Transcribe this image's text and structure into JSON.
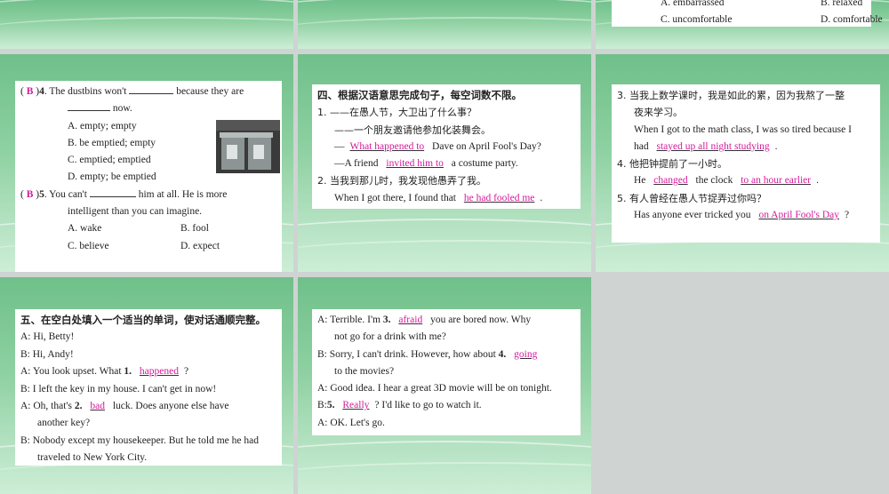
{
  "top_right": {
    "opt_a": "A. embarrassed",
    "opt_b": "B. relaxed",
    "opt_c": "C. uncomfortable",
    "opt_d": "D. comfortable"
  },
  "q4": {
    "answer": "B",
    "num": "4",
    "stem_start": ". The dustbins won't",
    "stem_end": "because they are",
    "stem_line2": "now.",
    "opt_a": "A. empty; empty",
    "opt_b": "B. be emptied; empty",
    "opt_c": "C. emptied; emptied",
    "opt_d": "D. empty; be emptied"
  },
  "q5": {
    "answer": "B",
    "num": "5",
    "stem_start": ". You can't",
    "stem_end": "him at all. He is more",
    "stem_line2": "intelligent than you can imagine.",
    "opt_a": "A. wake",
    "opt_b": "B. fool",
    "opt_c": "C. believe",
    "opt_d": "D. expect"
  },
  "section4": {
    "heading": "四、根据汉语意思完成句子，每空词数不限。",
    "s1_cn": "1. ——在愚人节，大卫出了什么事？",
    "s1_cn2": "——一个朋友邀请他参加化装舞会。",
    "s1_en1_pre": "—",
    "s1_en1_ans": "What happened to",
    "s1_en1_post": "Dave on April Fool's Day?",
    "s1_en2_pre": "—A friend",
    "s1_en2_ans": "invited him to",
    "s1_en2_post": "a costume party.",
    "s2_cn": "2. 当我到那儿时，我发现他愚弄了我。",
    "s2_en_pre": "When I got there, I found that",
    "s2_en_ans": "he had fooled me",
    "s2_en_post": "."
  },
  "section4b": {
    "s3_cn": "3. 当我上数学课时，我是如此的累，因为我熬了一整",
    "s3_cn2": "夜来学习。",
    "s3_en1": "When I got to the math class, I was so tired because I",
    "s3_en2_pre": "had",
    "s3_en2_ans": "stayed up all night studying",
    "s3_en2_post": ".",
    "s4_cn": "4. 他把钟提前了一小时。",
    "s4_en_pre": "He",
    "s4_en_ans1": "changed",
    "s4_en_mid": "the clock",
    "s4_en_ans2": "to an hour earlier",
    "s4_en_post": ".",
    "s5_cn": "5. 有人曾经在愚人节捉弄过你吗？",
    "s5_en_pre": "Has anyone ever tricked you",
    "s5_en_ans": "on April Fool's Day",
    "s5_en_post": "?"
  },
  "section5": {
    "heading": "五、在空白处填入一个适当的单词，使对话通顺完整。",
    "l1": "A: Hi, Betty!",
    "l2": "B: Hi, Andy!",
    "l3_pre": "A: You look upset. What",
    "l3_num": "1.",
    "l3_ans": "happened",
    "l3_post": "?",
    "l4": "B: I left the key in my house. I can't get in now!",
    "l5_pre": "A: Oh, that's",
    "l5_num": "2.",
    "l5_ans": "bad",
    "l5_post": "luck. Does anyone else have",
    "l6": "another key?",
    "l7": "B: Nobody except my housekeeper. But he told me he had",
    "l8": "traveled to New York City."
  },
  "section5b": {
    "l1_pre": "A: Terrible. I'm",
    "l1_num": "3.",
    "l1_ans": "afraid",
    "l1_post": "you are bored now. Why",
    "l2": "not go for a drink with me?",
    "l3_pre": "B: Sorry, I can't drink. However, how about",
    "l3_num": "4.",
    "l3_ans": "going",
    "l4": "to the movies?",
    "l5": "A: Good idea. I hear a great 3D movie will be on tonight.",
    "l6_pre": "B:",
    "l6_num": "5.",
    "l6_ans": "Really",
    "l6_post": "? I'd like to go to watch it.",
    "l7": "A: OK. Let's go."
  }
}
